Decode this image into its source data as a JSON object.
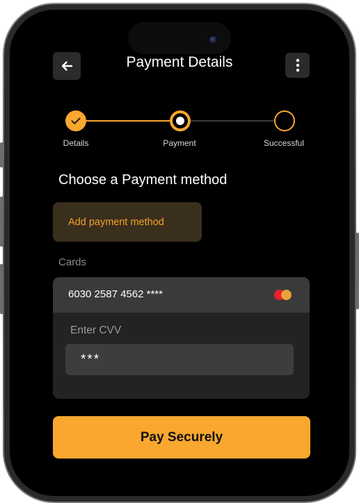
{
  "header": {
    "title": "Payment Details",
    "back_icon": "arrow-left-icon",
    "menu_icon": "more-vertical-icon"
  },
  "stepper": {
    "steps": [
      {
        "label": "Details",
        "state": "completed"
      },
      {
        "label": "Payment",
        "state": "current"
      },
      {
        "label": "Successful",
        "state": "pending"
      }
    ]
  },
  "payment": {
    "heading": "Choose a Payment method",
    "add_method_label": "Add payment method",
    "cards_label": "Cards",
    "card_number": "6030 2587 4562 ****",
    "card_brand_icon": "mastercard-icon",
    "cvv_label": "Enter CVV",
    "cvv_value": "***"
  },
  "footer": {
    "pay_label": "Pay Securely"
  },
  "colors": {
    "accent": "#f9a72f",
    "background": "#000000",
    "surface": "#2b2b2b"
  }
}
